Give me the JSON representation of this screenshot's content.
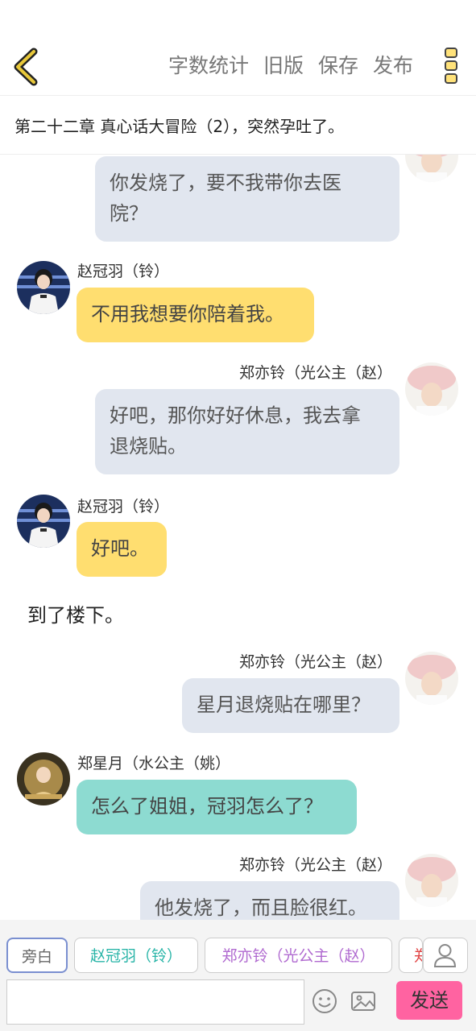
{
  "header": {
    "actions": [
      "字数统计",
      "旧版",
      "保存",
      "发布"
    ]
  },
  "chapter_title": "第二十二章 真心话大冒险（2），突然孕吐了。",
  "messages": [
    {
      "name": "",
      "text": "你发烧了，要不我带你去医院？",
      "lines": [
        "你发烧了，要不我带你去医",
        "院？"
      ]
    },
    {
      "name": "赵冠羽（铃）",
      "text": "不用我想要你陪着我。"
    },
    {
      "name": "郑亦铃（光公主（赵）",
      "text": "好吧，那你好好休息，我去拿退烧贴。",
      "lines": [
        "好吧，那你好好休息，我去拿",
        "退烧贴。"
      ]
    },
    {
      "name": "赵冠羽（铃）",
      "text": "好吧。"
    },
    {
      "narration": "到了楼下。"
    },
    {
      "name": "郑亦铃（光公主（赵）",
      "text": "星月退烧贴在哪里？"
    },
    {
      "name": "郑星月（水公主（姚）",
      "text": "怎么了姐姐，冠羽怎么了？"
    },
    {
      "name": "郑亦铃（光公主（赵）",
      "text": "他发烧了，而且脸很红。"
    }
  ],
  "roles": [
    {
      "label": "旁白",
      "color": "#666666"
    },
    {
      "label": "赵冠羽（铃）",
      "color": "#2ab5a8"
    },
    {
      "label": "郑亦铃（光公主（赵）",
      "color": "#b06ad0"
    },
    {
      "label": "郑",
      "color": "#e04040"
    }
  ],
  "composer": {
    "send_label": "发送",
    "input_value": ""
  },
  "colors": {
    "back_arrow": "#e0b400",
    "send_button": "#ff63a1",
    "bubble_grey": "#e1e6ef",
    "bubble_yellow": "#ffde70",
    "bubble_teal": "#8ddbd1"
  }
}
